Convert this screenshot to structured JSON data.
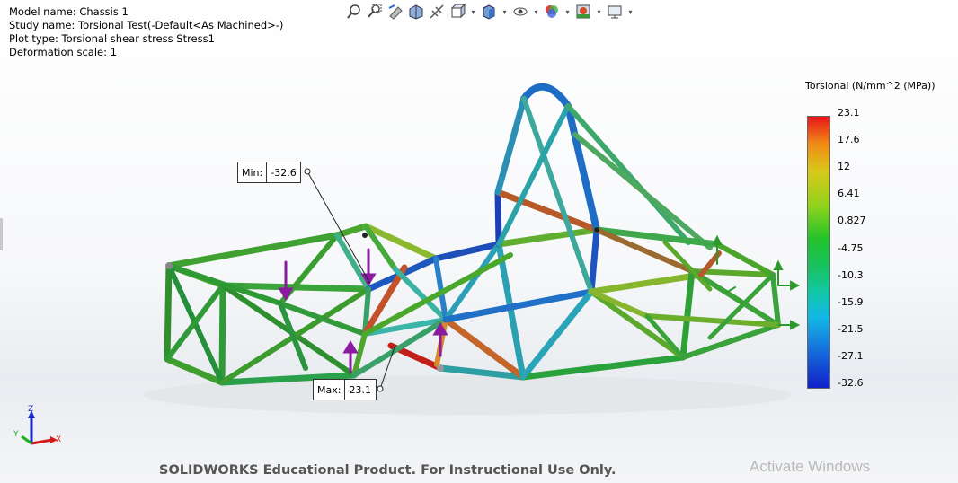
{
  "info": {
    "model_name": "Model name: Chassis 1",
    "study_name": "Study name: Torsional Test(-Default<As Machined>-)",
    "plot_type": "Plot type: Torsional shear stress Stress1",
    "deformation_scale": "Deformation scale: 1"
  },
  "toolbar": {
    "icons": [
      "zoom-to-fit-icon",
      "zoom-area-icon",
      "previous-view-icon",
      "section-view-icon",
      "dynamic-annotation-icon",
      "view-orientation-icon",
      "display-style-icon",
      "hide-show-icon",
      "edit-appearance-icon",
      "apply-scene-icon",
      "view-settings-icon"
    ]
  },
  "callouts": {
    "min_label": "Min:",
    "min_value": "-32.6",
    "max_label": "Max:",
    "max_value": "23.1"
  },
  "legend": {
    "title": "Torsional (N/mm^2 (MPa))",
    "ticks": [
      "23.1",
      "17.6",
      "12",
      "6.41",
      "0.827",
      "-4.75",
      "-10.3",
      "-15.9",
      "-21.5",
      "-27.1",
      "-32.6"
    ],
    "colors": [
      "#e8141a",
      "#f08b16",
      "#d8c81b",
      "#8fd21c",
      "#23c22b",
      "#19c25f",
      "#12c7a8",
      "#13b8e6",
      "#1775dd",
      "#1020c8"
    ]
  },
  "triad": {
    "x": "X",
    "y": "Y",
    "z": "Z"
  },
  "footer": {
    "watermark": "SOLIDWORKS Educational Product. For Instructional Use Only.",
    "activate": "Activate Windows"
  }
}
